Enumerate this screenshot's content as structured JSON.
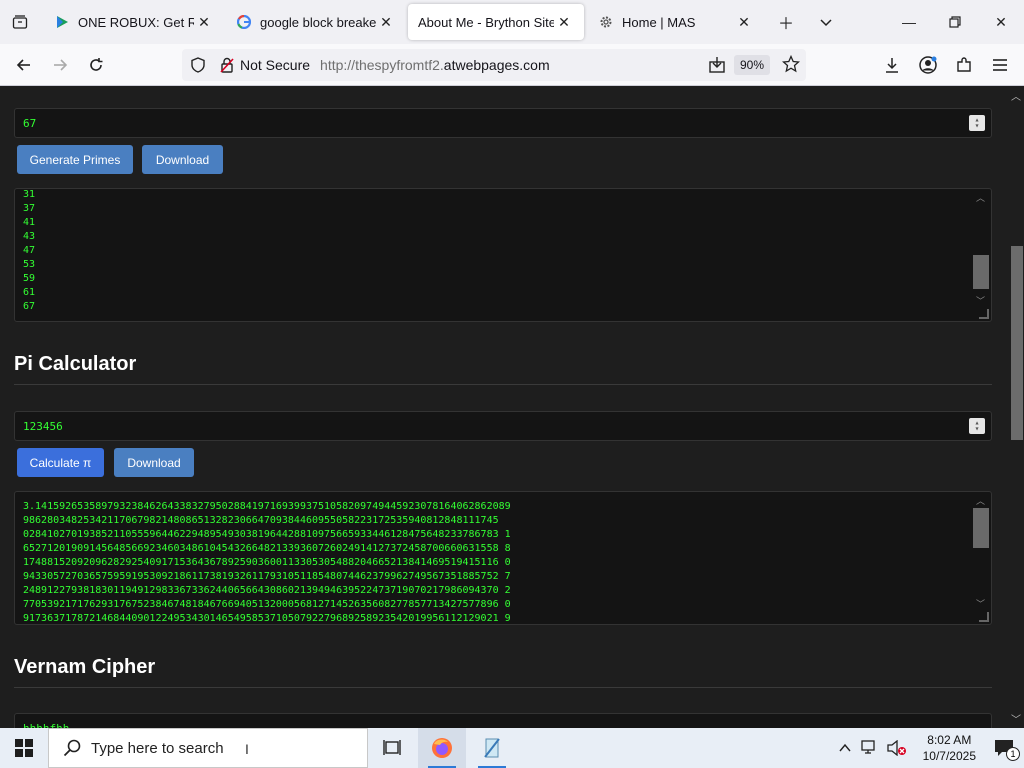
{
  "browser": {
    "tabs": [
      {
        "title": "ONE ROBUX: Get Real R",
        "favicon": "play-triangle-icon"
      },
      {
        "title": "google block breaker -",
        "favicon": "google-g-icon"
      },
      {
        "title": "About Me - Brython Site",
        "favicon": "none",
        "active": true
      },
      {
        "title": "Home | MAS",
        "favicon": "gear-icon"
      }
    ],
    "security_label": "Not Secure",
    "url_prefix": "http://thespyfromtf2.",
    "url_host": "atwebpages.com",
    "zoom": "90%"
  },
  "primes": {
    "input_value": "67",
    "generate_label": "Generate Primes",
    "download_label": "Download",
    "output": "31\n37\n41\n43\n47\n53\n59\n61\n67"
  },
  "pi": {
    "heading": "Pi Calculator",
    "input_value": "123456",
    "calculate_label": "Calculate π",
    "download_label": "Download",
    "output": "3.1415926535897932384626433832795028841971693993751058209749445923078164062862089\n9862803482534211706798214808651328230664709384460955058223172535940812848111745\n0284102701938521105559644622948954930381964428810975665933446128475648233786783 1\n6527120190914564856692346034861045432664821339360726024914127372458700660631558 8\n1748815209209628292540917153643678925903600113305305488204665213841469519415116 0\n9433057270365759591953092186117381932611793105118548074462379962749567351885752 7\n2489122793818301194912983367336244065664308602139494639522473719070217986094370 2\n7705392171762931767523846748184676694051320005681271452635608277857713427577896 0\n9173637178721468440901224953430146549585371050792279689258923542019956112129021 9"
  },
  "vernam": {
    "heading": "Vernam Cipher",
    "input_value": "hhhhfhh"
  },
  "taskbar": {
    "search_placeholder": "Type here to search",
    "time": "8:02 AM",
    "date": "10/7/2025",
    "notification_count": "1"
  }
}
